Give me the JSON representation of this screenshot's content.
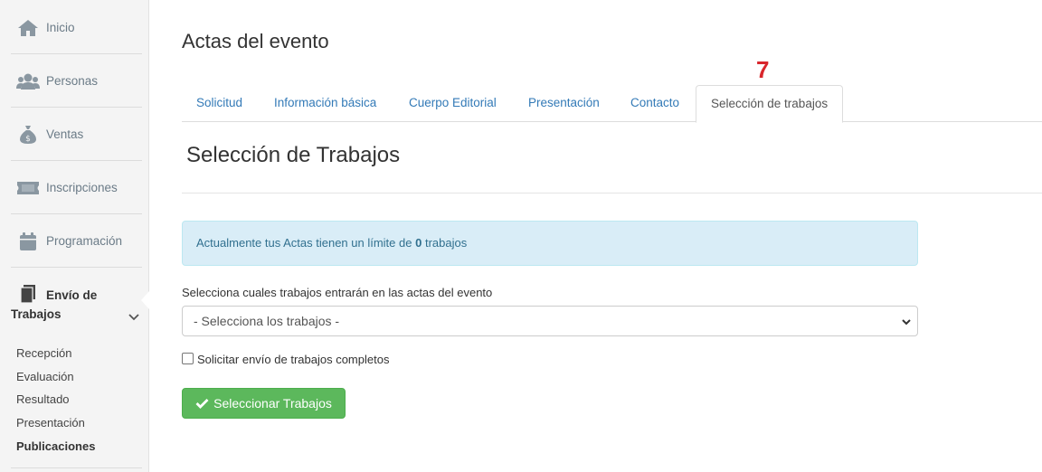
{
  "sidebar": {
    "items": [
      {
        "label": "Inicio",
        "icon": "home-icon"
      },
      {
        "label": "Personas",
        "icon": "users-icon"
      },
      {
        "label": "Ventas",
        "icon": "money-bag-icon"
      },
      {
        "label": "Inscripciones",
        "icon": "ticket-icon"
      },
      {
        "label": "Programación",
        "icon": "calendar-icon"
      }
    ],
    "active": {
      "label_line1": "Envío de",
      "label_line2": "Trabajos",
      "icon": "documents-icon"
    },
    "submenu": [
      "Recepción",
      "Evaluación",
      "Resultado",
      "Presentación",
      "Publicaciones"
    ],
    "current_submenu": "Publicaciones"
  },
  "main": {
    "title": "Actas del evento",
    "step_number": "7",
    "tabs": [
      "Solicitud",
      "Información básica",
      "Cuerpo Editorial",
      "Presentación",
      "Contacto",
      "Selección de trabajos"
    ],
    "active_tab": "Selección de trabajos",
    "section_title": "Selección de Trabajos",
    "alert": {
      "prefix": "Actualmente tus Actas tienen un límite de",
      "count": "0",
      "suffix": "trabajos"
    },
    "select_label": "Selecciona cuales trabajos entrarán en las actas del evento",
    "select_value": "- Selecciona los trabajos -",
    "checkbox_label": "Solicitar envío de trabajos completos",
    "checkbox_checked": false,
    "submit_label": "Seleccionar Trabajos"
  },
  "colors": {
    "sidebar_bg": "#f4f4f4",
    "link": "#337ab7",
    "alert_bg": "#d9edf7",
    "success": "#5cb85c",
    "step_red": "#d9262c"
  }
}
